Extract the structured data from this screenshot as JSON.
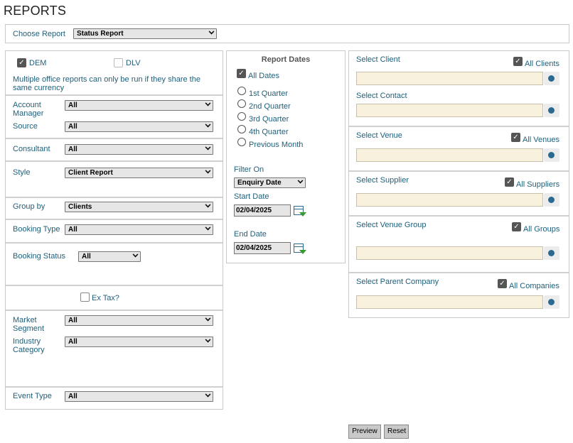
{
  "page": {
    "title": "REPORTS"
  },
  "choose_report": {
    "label": "Choose Report",
    "value": "Status Report"
  },
  "offices": {
    "dem_label": "DEM",
    "dem_checked": true,
    "dlv_label": "DLV",
    "dlv_checked": false,
    "note": "Multiple office reports can only be run if they share the same currency"
  },
  "filters": {
    "account_manager": {
      "label": "Account Manager",
      "value": "All"
    },
    "source": {
      "label": "Source",
      "value": "All"
    },
    "consultant": {
      "label": "Consultant",
      "value": "All"
    },
    "style": {
      "label": "Style",
      "value": "Client Report"
    },
    "group_by": {
      "label": "Group by",
      "value": "Clients"
    },
    "booking_type": {
      "label": "Booking Type",
      "value": "All"
    },
    "booking_status": {
      "label": "Booking Status",
      "value": "All"
    },
    "ex_tax": {
      "label": "Ex Tax?",
      "checked": false
    },
    "market_segment": {
      "label": "Market Segment",
      "value": "All"
    },
    "industry_category": {
      "label": "Industry Category",
      "value": "All"
    },
    "event_type": {
      "label": "Event Type",
      "value": "All"
    }
  },
  "report_dates": {
    "heading": "Report Dates",
    "all_dates_label": "All Dates",
    "all_dates_checked": true,
    "radios": [
      "1st Quarter",
      "2nd Quarter",
      "3rd Quarter",
      "4th Quarter",
      "Previous Month"
    ],
    "filter_on_label": "Filter On",
    "filter_on_value": "Enquiry Date",
    "start_label": "Start Date",
    "start_value": "02/04/2025",
    "end_label": "End Date",
    "end_value": "02/04/2025"
  },
  "selectors": {
    "client": {
      "label": "Select Client",
      "all_label": "All Clients",
      "checked": true
    },
    "contact": {
      "label": "Select Contact"
    },
    "venue": {
      "label": "Select Venue",
      "all_label": "All Venues",
      "checked": true
    },
    "supplier": {
      "label": "Select Supplier",
      "all_label": "All Suppliers",
      "checked": true
    },
    "venue_group": {
      "label": "Select Venue Group",
      "all_label": "All Groups",
      "checked": true
    },
    "parent_company": {
      "label": "Select Parent Company",
      "all_label": "All Companies",
      "checked": true
    }
  },
  "actions": {
    "preview": "Preview",
    "reset": "Reset"
  }
}
